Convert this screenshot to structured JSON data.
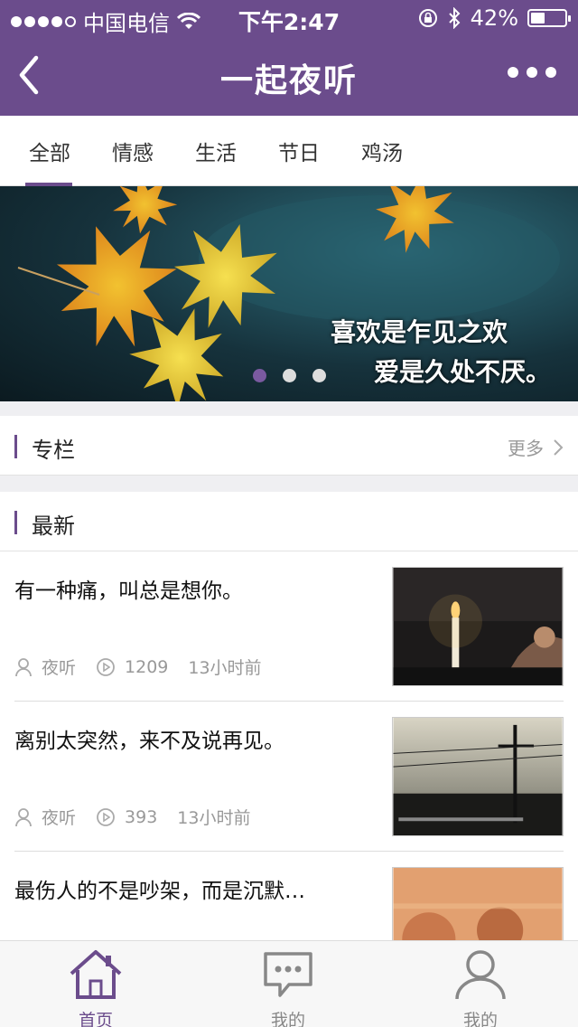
{
  "status_bar": {
    "carrier": "中国电信",
    "time": "下午2:47",
    "battery": "42%",
    "battery_level": 0.42
  },
  "nav": {
    "title": "一起夜听"
  },
  "tabs": [
    {
      "label": "全部",
      "active": true
    },
    {
      "label": "情感"
    },
    {
      "label": "生活"
    },
    {
      "label": "节日"
    },
    {
      "label": "鸡汤"
    }
  ],
  "banner": {
    "line1": "喜欢是乍见之欢",
    "line2": "爱是久处不厌。",
    "page_count": 3,
    "active_page": 0
  },
  "column_section": {
    "label": "专栏",
    "more": "更多"
  },
  "latest_section": {
    "label": "最新"
  },
  "articles": [
    {
      "title": "有一种痛，叫总是想你。",
      "author": "夜听",
      "plays": "1209",
      "time": "13小时前"
    },
    {
      "title": "离别太突然，来不及说再见。",
      "author": "夜听",
      "plays": "393",
      "time": "13小时前"
    },
    {
      "title": "最伤人的不是吵架，而是沉默…"
    }
  ],
  "bottom_nav": [
    {
      "label": "首页",
      "icon": "home-icon",
      "active": true
    },
    {
      "label": "我的",
      "icon": "chat-icon"
    },
    {
      "label": "我的",
      "icon": "user-icon"
    }
  ],
  "colors": {
    "brand": "#6b4c8c"
  }
}
